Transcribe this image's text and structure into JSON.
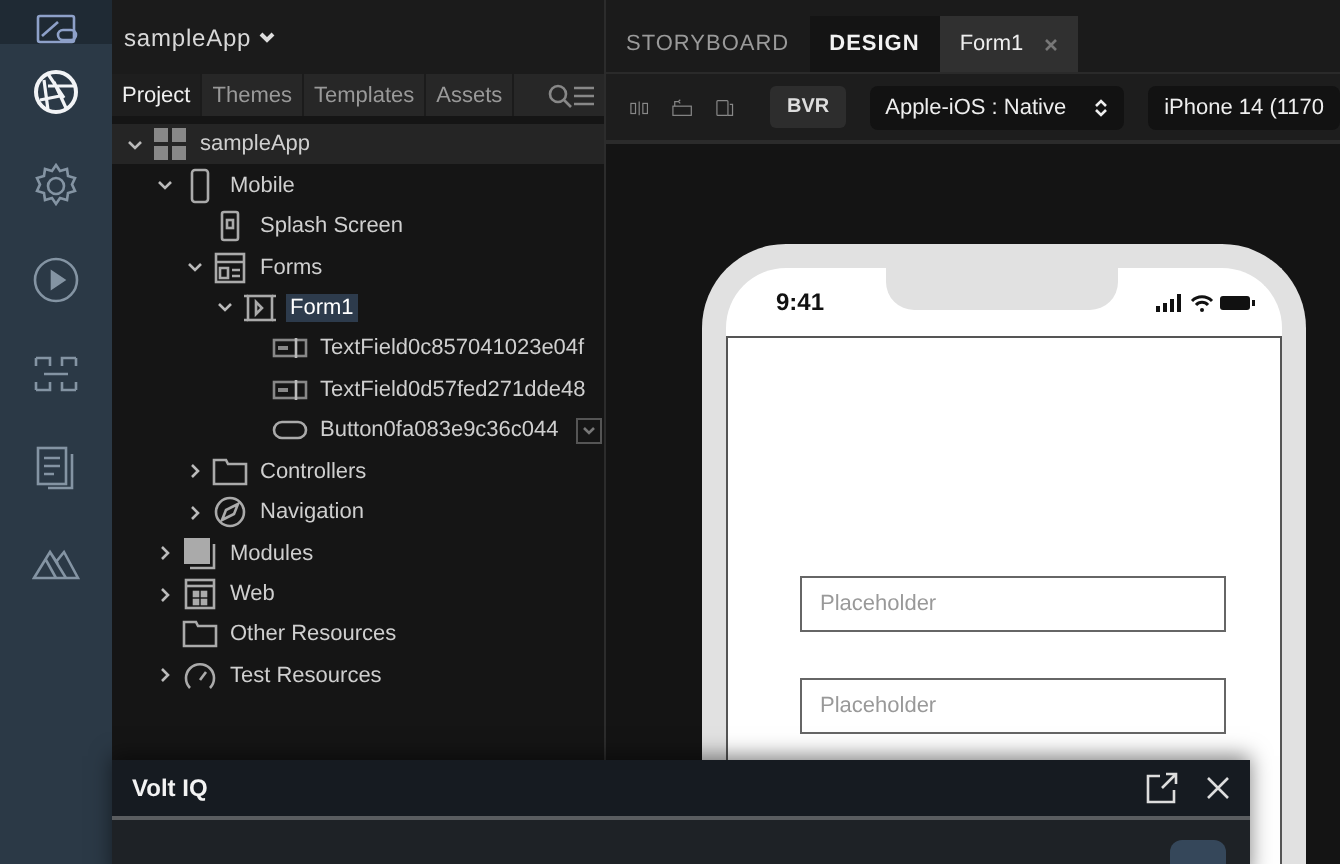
{
  "rail": [
    {
      "selected": false
    },
    {
      "selected": true
    },
    {
      "selected": false
    },
    {
      "selected": false
    },
    {
      "selected": false
    },
    {
      "selected": false
    },
    {
      "selected": false
    }
  ],
  "project_header": {
    "name": "sampleApp"
  },
  "project_tabs": [
    {
      "label": "Project",
      "selected": true
    },
    {
      "label": "Themes",
      "selected": false
    },
    {
      "label": "Templates",
      "selected": false
    },
    {
      "label": "Assets",
      "selected": false
    }
  ],
  "tree": [
    {
      "label": "sampleApp",
      "kind": "app",
      "expanded": true,
      "selected": false,
      "children": [
        {
          "label": "Mobile",
          "kind": "mobile",
          "expanded": true,
          "selected": false,
          "children": [
            {
              "label": "Splash Screen",
              "kind": "splash",
              "selected": false
            },
            {
              "label": "Forms",
              "kind": "forms",
              "expanded": true,
              "selected": false,
              "children": [
                {
                  "label": "Form1",
                  "kind": "form",
                  "expanded": true,
                  "selected": true,
                  "children": [
                    {
                      "label": "TextField0c857041023e04f",
                      "kind": "textfield",
                      "selected": false
                    },
                    {
                      "label": "TextField0d57fed271dde48",
                      "kind": "textfield",
                      "selected": false
                    },
                    {
                      "label": "Button0fa083e9c36c044",
                      "kind": "button",
                      "selected": false
                    }
                  ]
                }
              ]
            },
            {
              "label": "Controllers",
              "kind": "folder",
              "expanded": false,
              "selected": false
            },
            {
              "label": "Navigation",
              "kind": "navigation",
              "expanded": false,
              "selected": false
            }
          ]
        },
        {
          "label": "Modules",
          "kind": "modules",
          "expanded": false,
          "selected": false
        },
        {
          "label": "Web",
          "kind": "web",
          "expanded": false,
          "selected": false
        },
        {
          "label": "Other Resources",
          "kind": "folder",
          "selected": false
        },
        {
          "label": "Test Resources",
          "kind": "test",
          "expanded": false,
          "selected": false
        }
      ]
    }
  ],
  "editor_tabs": [
    {
      "label": "STORYBOARD",
      "selected": false
    },
    {
      "label": "DESIGN",
      "selected": true
    }
  ],
  "open_files": [
    {
      "label": "Form1",
      "selected": true
    }
  ],
  "toolbar": {
    "mode_button": "BVR",
    "platform": "Apple-iOS : Native",
    "device": "iPhone 14 (1170"
  },
  "phone": {
    "time": "9:41",
    "fields": [
      {
        "placeholder": "Placeholder"
      },
      {
        "placeholder": "Placeholder"
      }
    ]
  },
  "volt_iq": {
    "title": "Volt IQ"
  }
}
